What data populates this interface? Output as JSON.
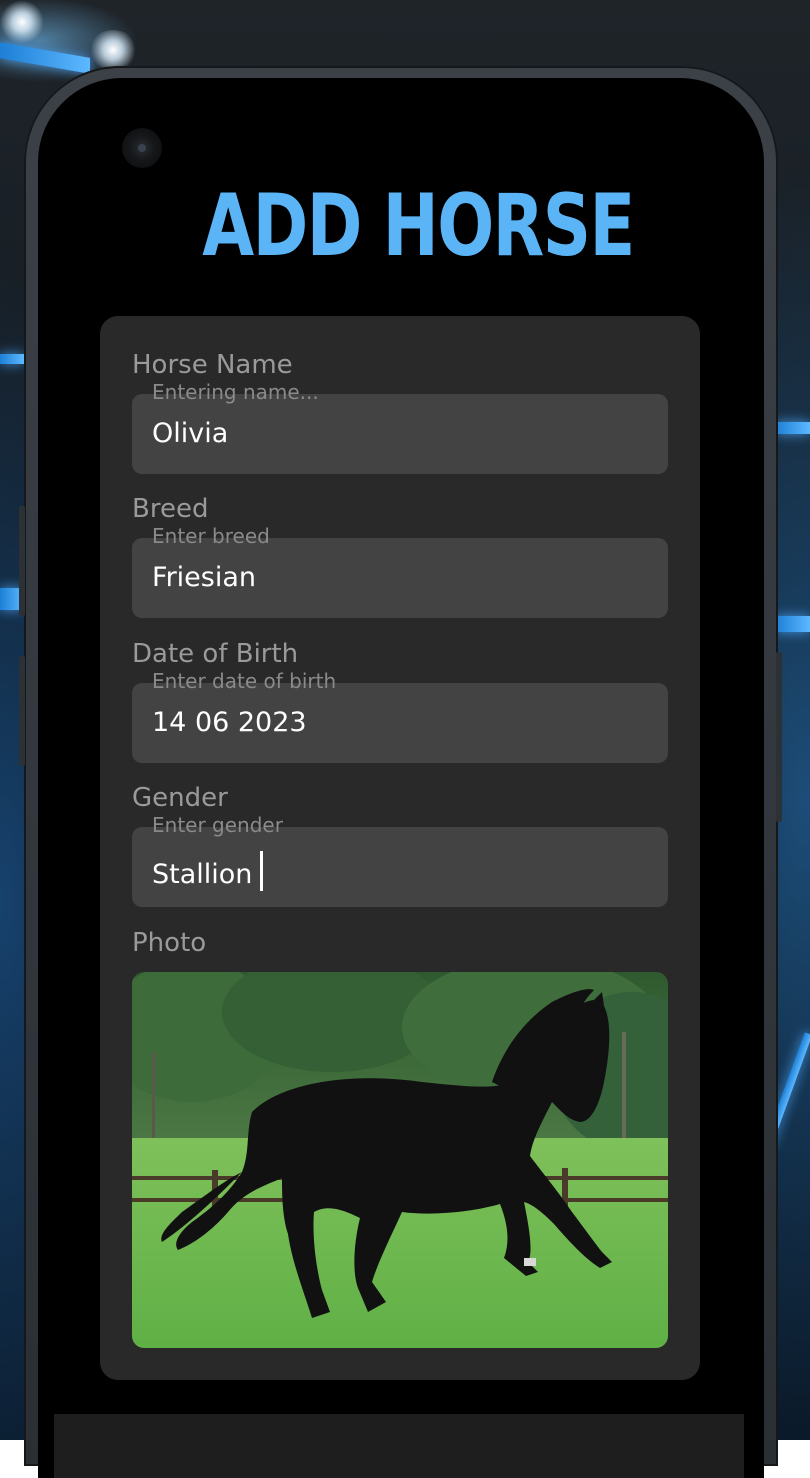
{
  "screen": {
    "title": "ADD HORSE"
  },
  "form": {
    "fields": [
      {
        "label": "Horse Name",
        "placeholder": "Entering name...",
        "value": "Olivia"
      },
      {
        "label": "Breed",
        "placeholder": "Enter breed",
        "value": "Friesian"
      },
      {
        "label": "Date of Birth",
        "placeholder": "Enter date of birth",
        "value": "14 06 2023"
      },
      {
        "label": "Gender",
        "placeholder": "Enter gender",
        "value": "Stallion"
      }
    ],
    "photo": {
      "label": "Photo",
      "image": "black-friesian-horse-galloping-on-grass"
    }
  },
  "colors": {
    "accent": "#5ab4f5",
    "background": "#000000",
    "card": "#292929",
    "input": "#434343"
  }
}
